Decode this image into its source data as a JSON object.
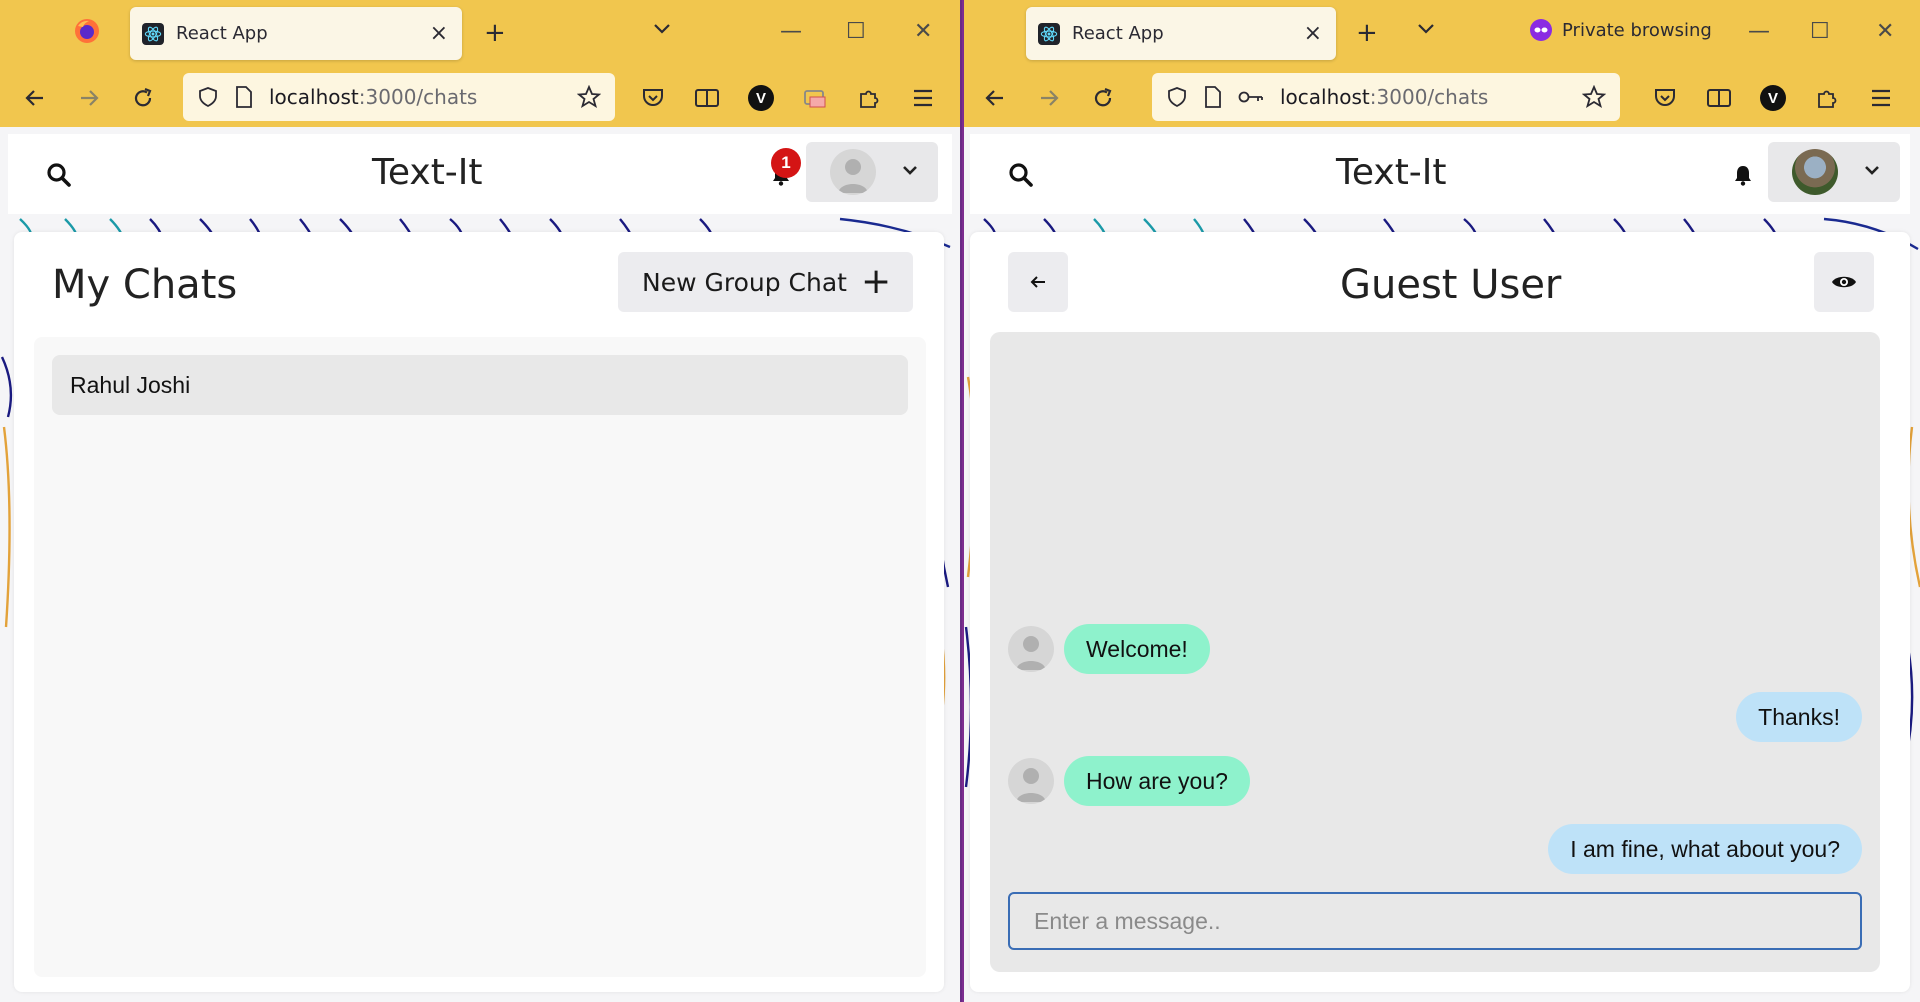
{
  "left_window": {
    "tab": {
      "title": "React App",
      "close": "×"
    },
    "new_tab": "+",
    "tab_list": "⌄",
    "window_controls": {
      "minimize": "—",
      "maximize": "☐",
      "close": "✕"
    },
    "url": {
      "host": "localhost",
      "path": ":3000/chats"
    },
    "app": {
      "brand": "Text-It",
      "notification_count": "1",
      "page_title": "My Chats",
      "new_group_label": "New Group Chat",
      "new_group_icon": "+",
      "chats": [
        {
          "name": "Rahul Joshi"
        }
      ]
    }
  },
  "right_window": {
    "tab": {
      "title": "React App",
      "close": "×"
    },
    "new_tab": "+",
    "tab_list": "⌄",
    "private_label": "Private browsing",
    "window_controls": {
      "minimize": "—",
      "maximize": "☐",
      "close": "✕"
    },
    "url": {
      "host": "localhost",
      "path": ":3000/chats"
    },
    "app": {
      "brand": "Text-It",
      "chat_title": "Guest User",
      "messages": [
        {
          "side": "in",
          "text": "Welcome!"
        },
        {
          "side": "out",
          "text": "Thanks!"
        },
        {
          "side": "in",
          "text": "How are you?"
        },
        {
          "side": "out",
          "text": "I am fine, what about you?"
        }
      ],
      "input_placeholder": "Enter a message.."
    }
  },
  "colors": {
    "browser_chrome": "#f1c64e",
    "incoming_bubble": "#8ef2cc",
    "outgoing_bubble": "#bee2f8",
    "notification_badge": "#d41414",
    "private_accent": "#8a2be2"
  },
  "icons": {
    "firefox": "firefox-icon",
    "react": "react-icon",
    "back": "arrow-left-icon",
    "forward": "arrow-right-icon",
    "reload": "reload-icon",
    "shield": "shield-icon",
    "page": "page-icon",
    "key": "key-icon",
    "star": "star-icon",
    "pocket": "pocket-icon",
    "reader": "reader-view-icon",
    "vpn": "v-extension-icon",
    "extensions": "puzzle-icon",
    "menu": "hamburger-menu-icon",
    "search": "search-icon",
    "bell": "bell-icon",
    "chevron": "chevron-down-icon",
    "eye": "eye-icon"
  }
}
